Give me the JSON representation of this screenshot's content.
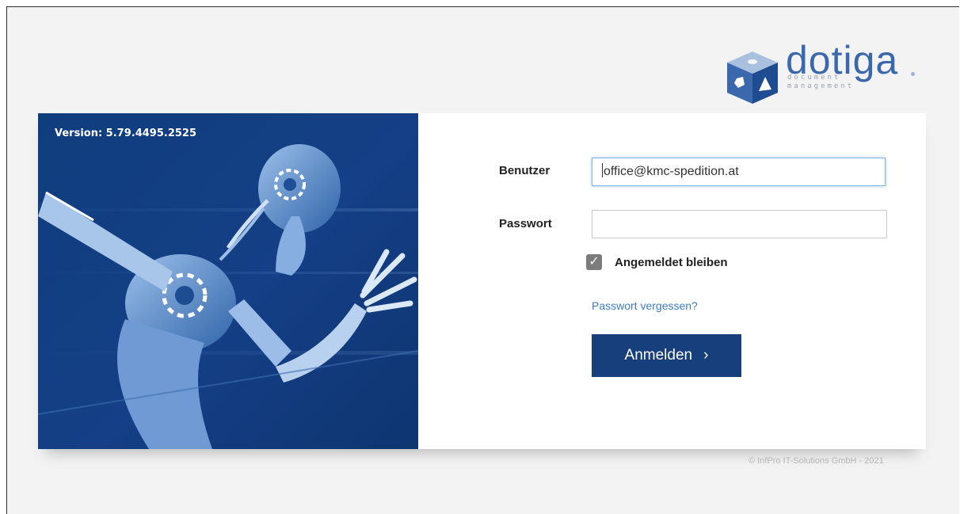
{
  "brand": {
    "name": "dotiga",
    "tagline_line1": "document",
    "tagline_line2": "management",
    "color": "#3b67ad"
  },
  "hero": {
    "version_text": "Version: 5.79.4495.2525",
    "background_color": "#153f86"
  },
  "form": {
    "username_label": "Benutzer",
    "username_value": "office@kmc-spedition.at",
    "password_label": "Passwort",
    "password_value": "",
    "remember_label": "Angemeldet bleiben",
    "remember_checked": true,
    "forgot_link": "Passwort vergessen?",
    "submit_label": "Anmelden",
    "submit_icon": "chevron-right-icon",
    "submit_glyph": "›",
    "check_glyph": "✓",
    "button_color": "#163f7c"
  },
  "footer": {
    "copyright": "© InfPro IT-Solutions GmbH - 2021"
  }
}
